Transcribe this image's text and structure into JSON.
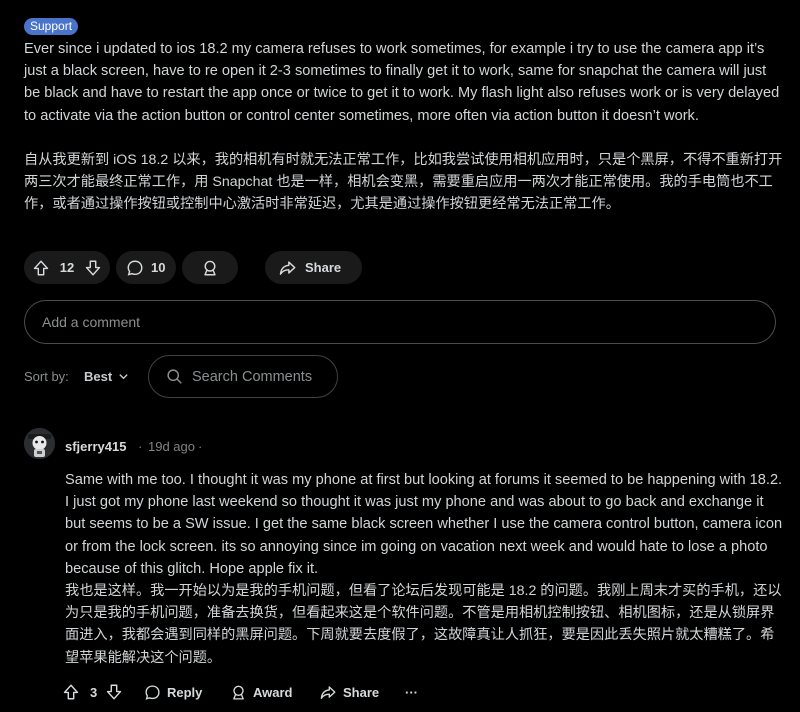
{
  "post": {
    "flair": "Support",
    "body_en": "Ever since i updated to ios 18.2 my camera refuses to work sometimes, for example i try to use the camera app it’s just a black screen, have to re open it 2-3 sometimes to finally get it to work, same for snapchat the camera will just be black and have to restart the app once or twice to get it to work. My flash light also refuses work or is very delayed to activate via the action button or control center sometimes, more often via action button it doesn’t work.",
    "body_zh": "自从我更新到 iOS 18.2 以来，我的相机有时就无法正常工作，比如我尝试使用相机应用时，只是个黑屏，不得不重新打开两三次才能最终正常工作，用 Snapchat 也是一样，相机会变黑，需要重启应用一两次才能正常使用。我的手电筒也不工作，或者通过操作按钮或控制中心激活时非常延迟，尤其是通过操作按钮更经常无法正常工作。",
    "vote_count": "12",
    "comment_count": "10",
    "share_label": "Share"
  },
  "comment_box": {
    "placeholder": "Add a comment"
  },
  "sort": {
    "label": "Sort by:",
    "value": "Best"
  },
  "search": {
    "placeholder": "Search Comments"
  },
  "comment": {
    "username": "sfjerry415",
    "separator": "·",
    "age": "19d ago",
    "separator_after": "·",
    "body_en": "Same with me too. I thought it was my phone at first but looking at forums it seemed to be happening with 18.2. I just got my phone last weekend so thought it was just my phone and was about to go back and exchange it but seems to be a SW issue. I get the same black screen whether I use the camera control button, camera icon or from the lock screen. its so annoying since im going on vacation next week and would hate to lose a photo because of this glitch. Hope apple fix it.",
    "body_zh": "我也是这样。我一开始以为是我的手机问题，但看了论坛后发现可能是 18.2 的问题。我刚上周末才买的手机，还以为只是我的手机问题，准备去换货，但看起来这是个软件问题。不管是用相机控制按钮、相机图标，还是从锁屏界面进入，我都会遇到同样的黑屏问题。下周就要去度假了，这故障真让人抓狂，要是因此丢失照片就太糟糕了。希望苹果能解决这个问题。",
    "vote_count": "3",
    "reply_label": "Reply",
    "award_label": "Award",
    "share_label": "Share",
    "more_label": "···"
  },
  "colors": {
    "background": "#000000",
    "flair": "#4a74c9",
    "pill": "#1a1a1b",
    "text": "#d7dadc",
    "muted": "#818384"
  },
  "icons": [
    "arrow-up-icon",
    "arrow-down-icon",
    "comment-bubble-icon",
    "award-icon",
    "share-arrow-icon",
    "chevron-down-icon",
    "search-icon",
    "more-icon"
  ]
}
